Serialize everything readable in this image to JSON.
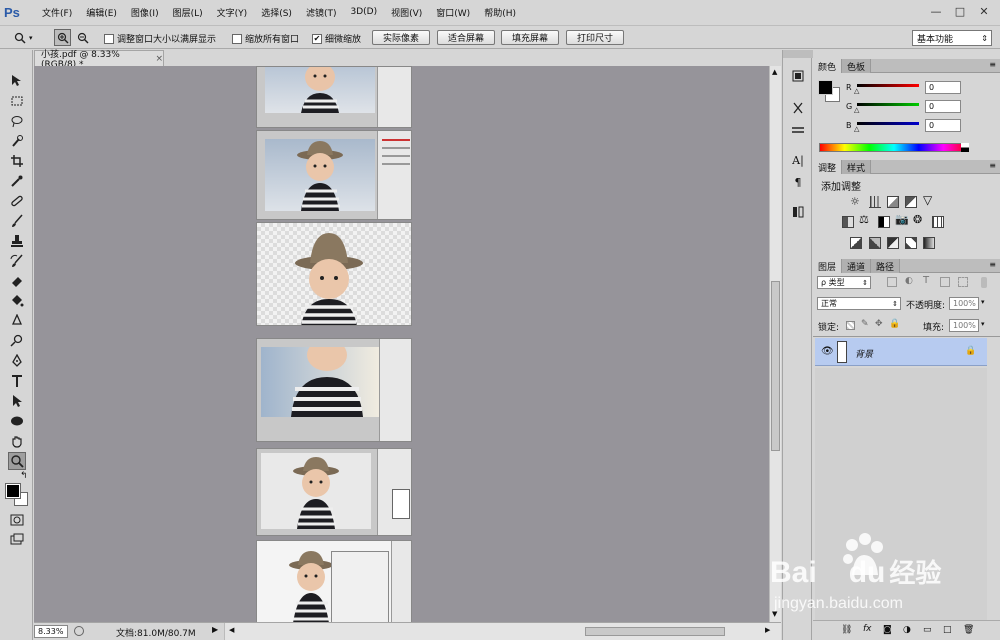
{
  "app": {
    "logo": "Ps",
    "menu": [
      "文件(F)",
      "编辑(E)",
      "图像(I)",
      "图层(L)",
      "文字(Y)",
      "选择(S)",
      "滤镜(T)",
      "3D(D)",
      "视图(V)",
      "窗口(W)",
      "帮助(H)"
    ],
    "window_controls": [
      "—",
      "□",
      "✕"
    ]
  },
  "options": {
    "check1": "调整窗口大小以满屏显示",
    "check2": "缩放所有窗口",
    "check3": "细微缩放",
    "btn_actual": "实际像素",
    "btn_fit": "适合屏幕",
    "btn_fill": "填充屏幕",
    "btn_print": "打印尺寸",
    "workspace": "基本功能"
  },
  "document": {
    "tab_title": "小孩.pdf @ 8.33%(RGB/8) *",
    "zoom": "8.33%",
    "doc_info": "文档:81.0M/80.7M"
  },
  "color_panel": {
    "tabs": [
      "颜色",
      "色板"
    ],
    "r_label": "R",
    "g_label": "G",
    "b_label": "B",
    "r_val": "0",
    "g_val": "0",
    "b_val": "0"
  },
  "adjust_panel": {
    "tabs": [
      "调整",
      "样式"
    ],
    "title": "添加调整"
  },
  "layers_panel": {
    "tabs": [
      "图层",
      "通道",
      "路径"
    ],
    "filter": "ρ 类型",
    "blend": "正常",
    "opacity_label": "不透明度:",
    "opacity": "100%",
    "lock_label": "锁定:",
    "fill_label": "填充:",
    "fill": "100%",
    "layer_name": "背景"
  },
  "watermark": {
    "brand": "Bai",
    "brand2": "du",
    "cn": "经验",
    "url": "jingyan.baidu.com"
  }
}
